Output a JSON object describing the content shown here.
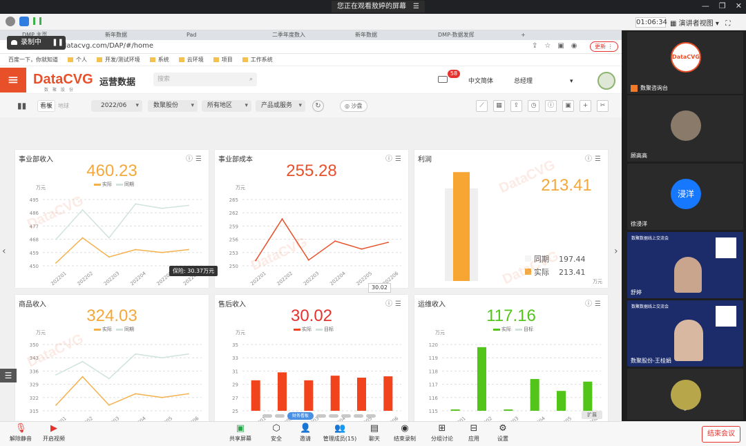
{
  "share_banner": {
    "text": "您正在观看敖婷的屏幕",
    "icon": "menu-icon"
  },
  "meeting": {
    "timer": "01:06:34",
    "view_label": "演讲者视图"
  },
  "browser": {
    "tabs": [
      "DMP 主页",
      "新年数据",
      "Pad",
      "二季年度数入",
      "新年数据",
      "DMP-数据发挥"
    ],
    "record_label": "录制中",
    "url": "datacvg.com/DAP/#/home",
    "update_label": "更新",
    "bookmarks": [
      "百度一下，你就知道",
      "个人",
      "开发/测试环境",
      "系统",
      "云环境",
      "项目",
      "工作系统"
    ]
  },
  "app": {
    "logo": "DataCVG",
    "logo_sub": "数聚股份",
    "title": "运营数据",
    "search_placeholder": "搜索",
    "badge": "58",
    "language": "中文简体",
    "user": "总经理"
  },
  "filters": {
    "view_tabs": [
      "看板",
      "地球"
    ],
    "period": "2022/06",
    "company": "数聚股份",
    "region": "所有地区",
    "service": "产品或服务",
    "sandbox": "沙盘"
  },
  "watermark": "DataCVG",
  "cards": [
    {
      "title": "事业部收入",
      "value": "460.23",
      "value_color": "#f5a83a",
      "unit": "万元",
      "legend": [
        "实际",
        "同期"
      ],
      "colors": [
        "#f5b04a",
        "#cfe3dc"
      ]
    },
    {
      "title": "事业部成本",
      "value": "255.28",
      "value_color": "#e8502a",
      "unit": "万元"
    },
    {
      "title": "利润",
      "value": "213.41",
      "value_color": "#f5a83a",
      "unit": "万元",
      "legend_rows": [
        {
          "label": "同期",
          "value": "197.44"
        },
        {
          "label": "实际",
          "value": "213.41"
        }
      ]
    },
    {
      "title": "商品收入",
      "value": "324.03",
      "value_color": "#f5a83a",
      "unit": "万元",
      "legend": [
        "实际",
        "同期"
      ]
    },
    {
      "title": "售后收入",
      "value": "30.02",
      "value_color": "#e5322d",
      "unit": "万元",
      "legend": [
        "实际",
        "目标"
      ]
    },
    {
      "title": "运维收入",
      "value": "117.16",
      "value_color": "#52c41a",
      "unit": "万元",
      "legend": [
        "实际",
        "目标"
      ]
    }
  ],
  "tooltip": "保险: 30.37万元",
  "tooltip2": "30.02",
  "bottom_nav": {
    "active": "财务看板",
    "expand": "扩展"
  },
  "chart_data": [
    {
      "type": "line",
      "title": "事业部收入",
      "categories": [
        "202201",
        "202202",
        "202203",
        "202204",
        "202205",
        "202206"
      ],
      "ylim": [
        450,
        495
      ],
      "yticks": [
        450,
        459,
        468,
        477,
        486,
        495
      ],
      "series": [
        {
          "name": "实际",
          "values": [
            452,
            469,
            456,
            461,
            459,
            461
          ]
        },
        {
          "name": "同期",
          "values": [
            468,
            488,
            469,
            492,
            489,
            491
          ]
        }
      ]
    },
    {
      "type": "line",
      "title": "事业部成本",
      "categories": [
        "202201",
        "202202",
        "202203",
        "202204",
        "202205",
        "202206"
      ],
      "ylim": [
        250,
        265
      ],
      "yticks": [
        250,
        253,
        256,
        259,
        262,
        265
      ],
      "series": [
        {
          "values": [
            251.2,
            260.6,
            251.3,
            255.6,
            253.8,
            255.3
          ]
        }
      ]
    },
    {
      "type": "bar",
      "title": "利润",
      "categories": [
        "利润"
      ],
      "series": [
        {
          "name": "同期",
          "values": [
            197.44
          ]
        },
        {
          "name": "实际",
          "values": [
            213.41
          ]
        }
      ]
    },
    {
      "type": "line",
      "title": "商品收入",
      "categories": [
        "202201",
        "202202",
        "202203",
        "202204",
        "202205",
        "202206"
      ],
      "ylim": [
        315,
        350
      ],
      "yticks": [
        315,
        322,
        329,
        336,
        343,
        350
      ],
      "series": [
        {
          "name": "实际",
          "values": [
            318,
            333,
            318,
            324,
            322,
            324
          ]
        },
        {
          "name": "同期",
          "values": [
            334,
            341,
            332,
            345,
            343,
            345
          ]
        }
      ]
    },
    {
      "type": "bar",
      "title": "售后收入",
      "categories": [
        "202201",
        "202202",
        "202203",
        "202204",
        "202205",
        "202206"
      ],
      "ylim": [
        25,
        35
      ],
      "yticks": [
        25,
        27,
        29,
        31,
        33,
        35
      ],
      "series": [
        {
          "name": "实际",
          "values": [
            29.6,
            30.8,
            29.6,
            30.3,
            30.0,
            30.2
          ]
        }
      ]
    },
    {
      "type": "bar",
      "title": "运维收入",
      "categories": [
        "202201",
        "202202",
        "202203",
        "202204",
        "202205",
        "202206"
      ],
      "ylim": [
        115,
        120
      ],
      "yticks": [
        115,
        116,
        117,
        118,
        119,
        120
      ],
      "series": [
        {
          "name": "实际",
          "values": [
            115.1,
            119.8,
            115.1,
            117.4,
            116.5,
            117.2
          ]
        }
      ]
    }
  ],
  "participants": [
    {
      "name": "数聚咨询台",
      "avatar_text": "DataCVG"
    },
    {
      "name": "顾高高"
    },
    {
      "name": "徐浸洋",
      "avatar_text": "浸洋"
    },
    {
      "name": "舒婷",
      "slide_title": "数聚数据线上交流会"
    },
    {
      "name": "数聚股份-王桂娟",
      "slide_title": "数聚数据线上交流会"
    },
    {
      "name": ""
    }
  ],
  "bottom_bar": {
    "left": [
      "解除静音",
      "开启视频"
    ],
    "center": [
      "共享屏幕",
      "安全",
      "邀请",
      "管理成员(15)",
      "聊天",
      "结束录制",
      "分组讨论",
      "应用",
      "设置"
    ],
    "end": "结束会议"
  }
}
